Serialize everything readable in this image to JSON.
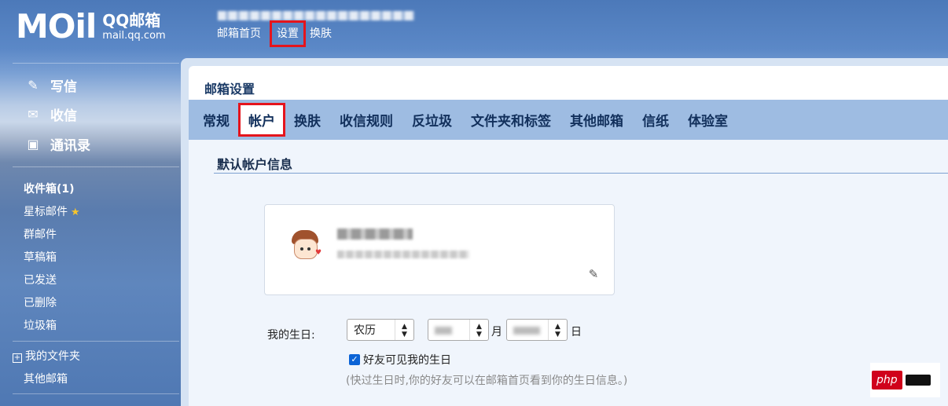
{
  "header": {
    "logo_main": "MOil",
    "logo_brand": "QQ邮箱",
    "logo_url": "mail.qq.com",
    "nav": [
      "邮箱首页",
      "设置",
      "换肤"
    ]
  },
  "sidebar": {
    "primary": [
      {
        "label": "写信",
        "icon": "pencil-icon"
      },
      {
        "label": "收信",
        "icon": "envelope-icon"
      },
      {
        "label": "通讯录",
        "icon": "contacts-icon"
      }
    ],
    "folders": [
      {
        "label": "收件箱(1)",
        "bold": true
      },
      {
        "label": "星标邮件",
        "icon": "star-icon"
      },
      {
        "label": "群邮件"
      },
      {
        "label": "草稿箱"
      },
      {
        "label": "已发送"
      },
      {
        "label": "已删除"
      },
      {
        "label": "垃圾箱"
      }
    ],
    "my_folders": "我的文件夹",
    "other_mailbox": "其他邮箱"
  },
  "main": {
    "title": "邮箱设置",
    "tabs": [
      "常规",
      "帐户",
      "换肤",
      "收信规则",
      "反垃圾",
      "文件夹和标签",
      "其他邮箱",
      "信纸",
      "体验室"
    ],
    "active_tab": "帐户",
    "section_title": "默认帐户信息",
    "birthday": {
      "label": "我的生日:",
      "calendar_select": "农历",
      "month_unit": "月",
      "day_unit": "日",
      "checkbox_label": "好友可见我的生日",
      "checkbox_checked": true,
      "hint": "(快过生日时,你的好友可以在邮箱首页看到你的生日信息。)"
    }
  },
  "watermark": {
    "text": "php"
  },
  "colors": {
    "highlight": "#e5141c",
    "tab_bar": "#9ebce2",
    "accent_blue": "#0b63d6"
  }
}
